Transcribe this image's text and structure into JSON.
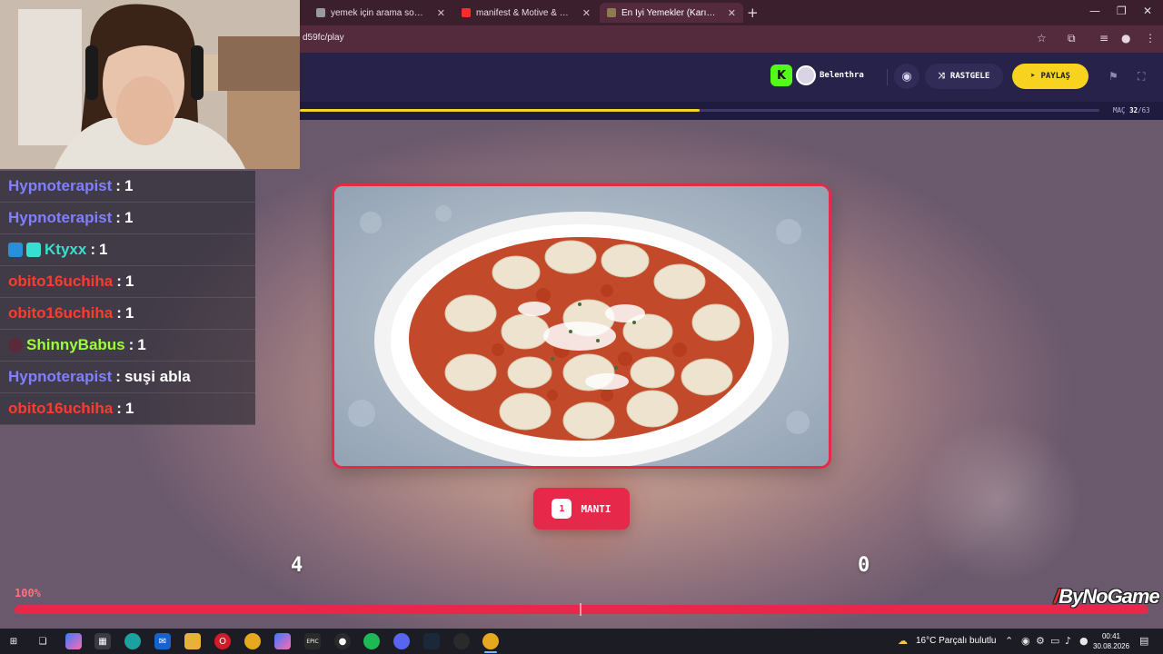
{
  "browser": {
    "tabs": [
      {
        "title": "yemek için arama sonuçları - Q",
        "active": false
      },
      {
        "title": "manifest & Motive & Pango - p",
        "active": false
      },
      {
        "title": "En İyi Yemekler (Karışık) - Tier Li",
        "active": true
      }
    ],
    "new_tab": "+",
    "url": "d59fc/play"
  },
  "site": {
    "user_name": "Belenthra",
    "kick_letter": "K",
    "random_label": "RASTGELE",
    "share_label": "PAYLAŞ",
    "match_label": "MAÇ",
    "match_current": "32",
    "match_total": "/63",
    "match_progress": 0.5
  },
  "game": {
    "answer_number": "1",
    "answer_label": "MANTI",
    "score_left": "4",
    "score_right": "0",
    "timer_percent": "100%",
    "watermark": "ByNoGame"
  },
  "chat": [
    {
      "user": "Hypnoterapist",
      "color": "#7f7fff",
      "msg": "1",
      "badge": ""
    },
    {
      "user": "Hypnoterapist",
      "color": "#7f7fff",
      "msg": "1",
      "badge": ""
    },
    {
      "user": "Ktyxx",
      "color": "#35e0d0",
      "msg": "1",
      "badge": "double"
    },
    {
      "user": "obito16uchiha",
      "color": "#ff3b2e",
      "msg": "1",
      "badge": ""
    },
    {
      "user": "obito16uchiha",
      "color": "#ff3b2e",
      "msg": "1",
      "badge": ""
    },
    {
      "user": "ShinnyBabus",
      "color": "#9aff3a",
      "msg": "1",
      "badge": "avatar"
    },
    {
      "user": "Hypnoterapist",
      "color": "#7f7fff",
      "msg": "suşi abla",
      "badge": ""
    },
    {
      "user": "obito16uchiha",
      "color": "#ff3b2e",
      "msg": "1",
      "badge": ""
    }
  ],
  "taskbar": {
    "weather": "16°C  Parçalı bulutlu",
    "time": "00:41",
    "date": "30.08.2026"
  },
  "colors": {
    "accent_red": "#e6294a",
    "accent_yellow": "#f7d320",
    "header_bg": "#26224a"
  }
}
